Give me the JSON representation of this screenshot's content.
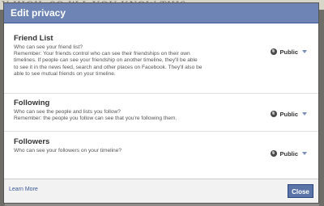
{
  "background_text": "Y HIGH, SO I'LL YOU KNOW THIS",
  "dialog": {
    "title": "Edit privacy",
    "sections": [
      {
        "title": "Friend List",
        "desc_lines": [
          "Who can see your friend list?",
          "Remember: Your friends control who can see their friendships on their own",
          "timelines. If people can see your friendship on another timeline, they'll be able",
          "to see it in the news feed, search and other places on Facebook. They'll also be",
          "able to see mutual friends on your timeline."
        ],
        "privacy": "Public",
        "privacy_icon": "globe-icon"
      },
      {
        "title": "Following",
        "desc_lines": [
          "Who can see the people and lists you follow?",
          "Remember: the people you follow can see that you're following them."
        ],
        "privacy": "Public",
        "privacy_icon": "globe-icon"
      },
      {
        "title": "Followers",
        "desc_lines": [
          "Who can see your followers on your timeline?"
        ],
        "privacy": "Public",
        "privacy_icon": "globe-icon"
      }
    ],
    "footer": {
      "learn_more": "Learn More",
      "close": "Close"
    }
  },
  "colors": {
    "header": "#6d84b4",
    "link": "#3b5998",
    "button": "#5b74a8"
  }
}
